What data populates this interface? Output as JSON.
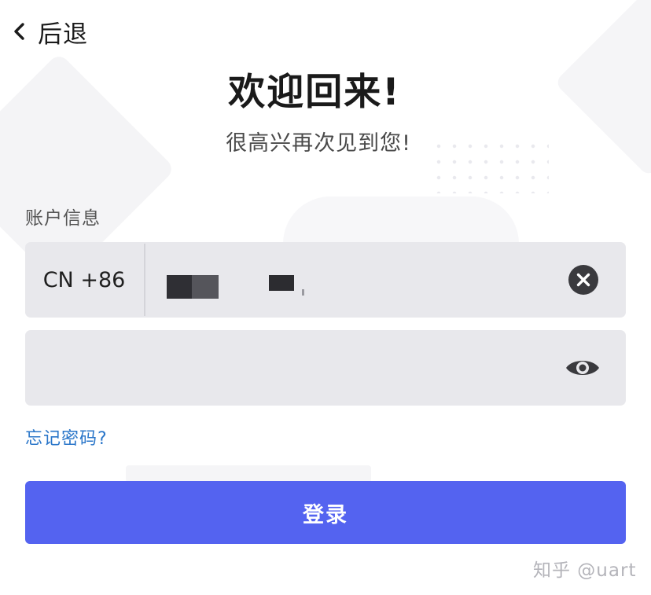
{
  "nav": {
    "back_label": "后退",
    "back_icon": "chevron-left-icon"
  },
  "header": {
    "title": "欢迎回来!",
    "subtitle": "很高兴再次见到您!"
  },
  "account_section": {
    "label": "账户信息"
  },
  "phone_field": {
    "country_code": "CN +86",
    "value_redacted": true,
    "clear_icon": "clear-circle-x-icon"
  },
  "password_field": {
    "value": "",
    "visibility_icon": "eye-icon"
  },
  "forgot_password": {
    "label": "忘记密码?"
  },
  "login_button": {
    "label": "登录"
  },
  "watermark": {
    "text": "知乎 @uart"
  },
  "colors": {
    "background": "#ffffff",
    "input_background": "#e8e8ec",
    "primary_button": "#5463f0",
    "link": "#2a76c9",
    "title_text": "#1a1a1a",
    "subtitle_text": "#4a4a4a",
    "icon_dark": "#3a3a3e"
  }
}
